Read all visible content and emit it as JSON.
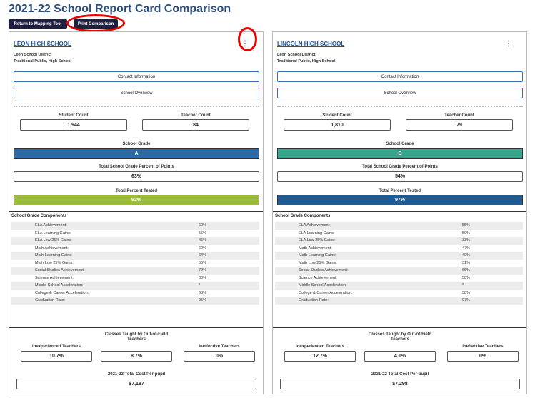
{
  "page": {
    "title": "2021-22 School Report Card Comparison",
    "return_label": "Return to Mapping Tool",
    "print_label": "Print Comparison"
  },
  "labels": {
    "contact": "Contact Information",
    "overview": "School Overview",
    "student_count": "Student Count",
    "teacher_count": "Teacher Count",
    "school_grade": "School Grade",
    "pct_points": "Total School Grade Percent of Points",
    "pct_tested": "Total Percent Tested",
    "components": "School Grade Components",
    "inexperienced": "Inexperienced Teachers",
    "out_of_field": "Classes Taught by Out-of-Field Teachers",
    "ineffective": "Ineffective Teachers",
    "cost": "2021-22 Total Cost Per-pupil",
    "menu": "⋮"
  },
  "colors": {
    "grade_a": "#2f6aa3",
    "grade_b": "#3aa38c",
    "tested_left": "#9bbb3a",
    "tested_right": "#1f5a93"
  },
  "schools": [
    {
      "name": "LEON HIGH SCHOOL",
      "district": "Leon School District",
      "type": "Traditional Public, High School",
      "student_count": "1,944",
      "teacher_count": "84",
      "grade": "A",
      "pct_points": "63%",
      "pct_tested": "92%",
      "components": [
        {
          "label": "ELA Achievement:",
          "value": "60%"
        },
        {
          "label": "ELA Learning Gains:",
          "value": "56%"
        },
        {
          "label": "ELA Low 25% Gains:",
          "value": "46%"
        },
        {
          "label": "Math Achievement:",
          "value": "62%"
        },
        {
          "label": "Math Learning Gains:",
          "value": "64%"
        },
        {
          "label": "Math Low 25% Gains:",
          "value": "56%"
        },
        {
          "label": "Social Studies Achievement:",
          "value": "72%"
        },
        {
          "label": "Science Achievement:",
          "value": "80%"
        },
        {
          "label": "Middle School Acceleration:",
          "value": "*"
        },
        {
          "label": "College & Career Acceleration:",
          "value": "63%"
        },
        {
          "label": "Graduation Rate:",
          "value": "95%"
        }
      ],
      "inexperienced": "10.7%",
      "out_of_field": "8.7%",
      "ineffective": "0%",
      "cost": "$7,187"
    },
    {
      "name": "LINCOLN HIGH SCHOOL",
      "district": "Leon School District",
      "type": "Traditional Public, High School",
      "student_count": "1,810",
      "teacher_count": "79",
      "grade": "B",
      "pct_points": "54%",
      "pct_tested": "97%",
      "components": [
        {
          "label": "ELA Achievement:",
          "value": "55%"
        },
        {
          "label": "ELA Learning Gains:",
          "value": "50%"
        },
        {
          "label": "ELA Low 25% Gains:",
          "value": "33%"
        },
        {
          "label": "Math Achievement:",
          "value": "47%"
        },
        {
          "label": "Math Learning Gains:",
          "value": "40%"
        },
        {
          "label": "Math Low 25% Gains:",
          "value": "31%"
        },
        {
          "label": "Social Studies Achievement:",
          "value": "66%"
        },
        {
          "label": "Science Achievement:",
          "value": "58%"
        },
        {
          "label": "Middle School Acceleration:",
          "value": "*"
        },
        {
          "label": "College & Career Acceleration:",
          "value": "58%"
        },
        {
          "label": "Graduation Rate:",
          "value": "97%"
        }
      ],
      "inexperienced": "12.7%",
      "out_of_field": "4.1%",
      "ineffective": "0%",
      "cost": "$7,298"
    }
  ]
}
